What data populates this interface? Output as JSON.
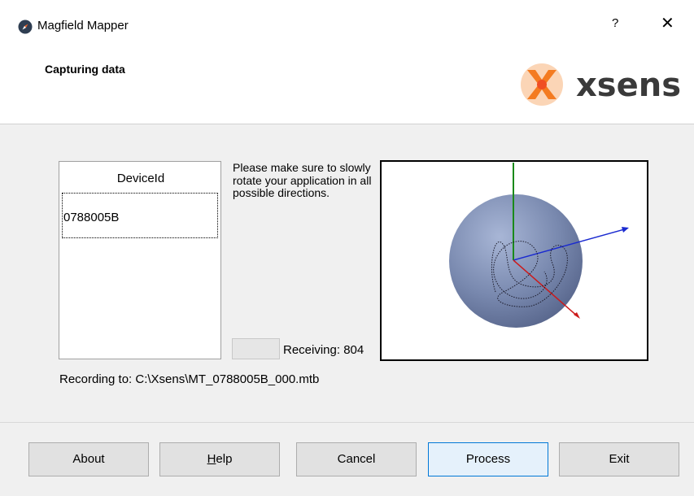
{
  "window": {
    "title": "Magfield Mapper",
    "help_glyph": "?",
    "close_glyph": "✕"
  },
  "header": {
    "heading": "Capturing data",
    "logo_text": "xsens",
    "logo_color": "#f7931e"
  },
  "device_list": {
    "column_header": "DeviceId",
    "rows": [
      "0788005B"
    ]
  },
  "instructions": "Please make sure to slowly rotate your application in all possible directions.",
  "status": {
    "receiving_label": "Receiving: 804"
  },
  "recording": "Recording to: C:\\Xsens\\MT_0788005B_000.mtb",
  "buttons": {
    "about": "About",
    "help_mnemonic": "H",
    "help_rest": "elp",
    "cancel": "Cancel",
    "process": "Process",
    "exit": "Exit"
  },
  "visualization": {
    "sphere_color": "#7c8db4",
    "axis_colors": {
      "up": "#1a8a1a",
      "right": "#1a2ad0",
      "down": "#cc1a1a"
    }
  }
}
